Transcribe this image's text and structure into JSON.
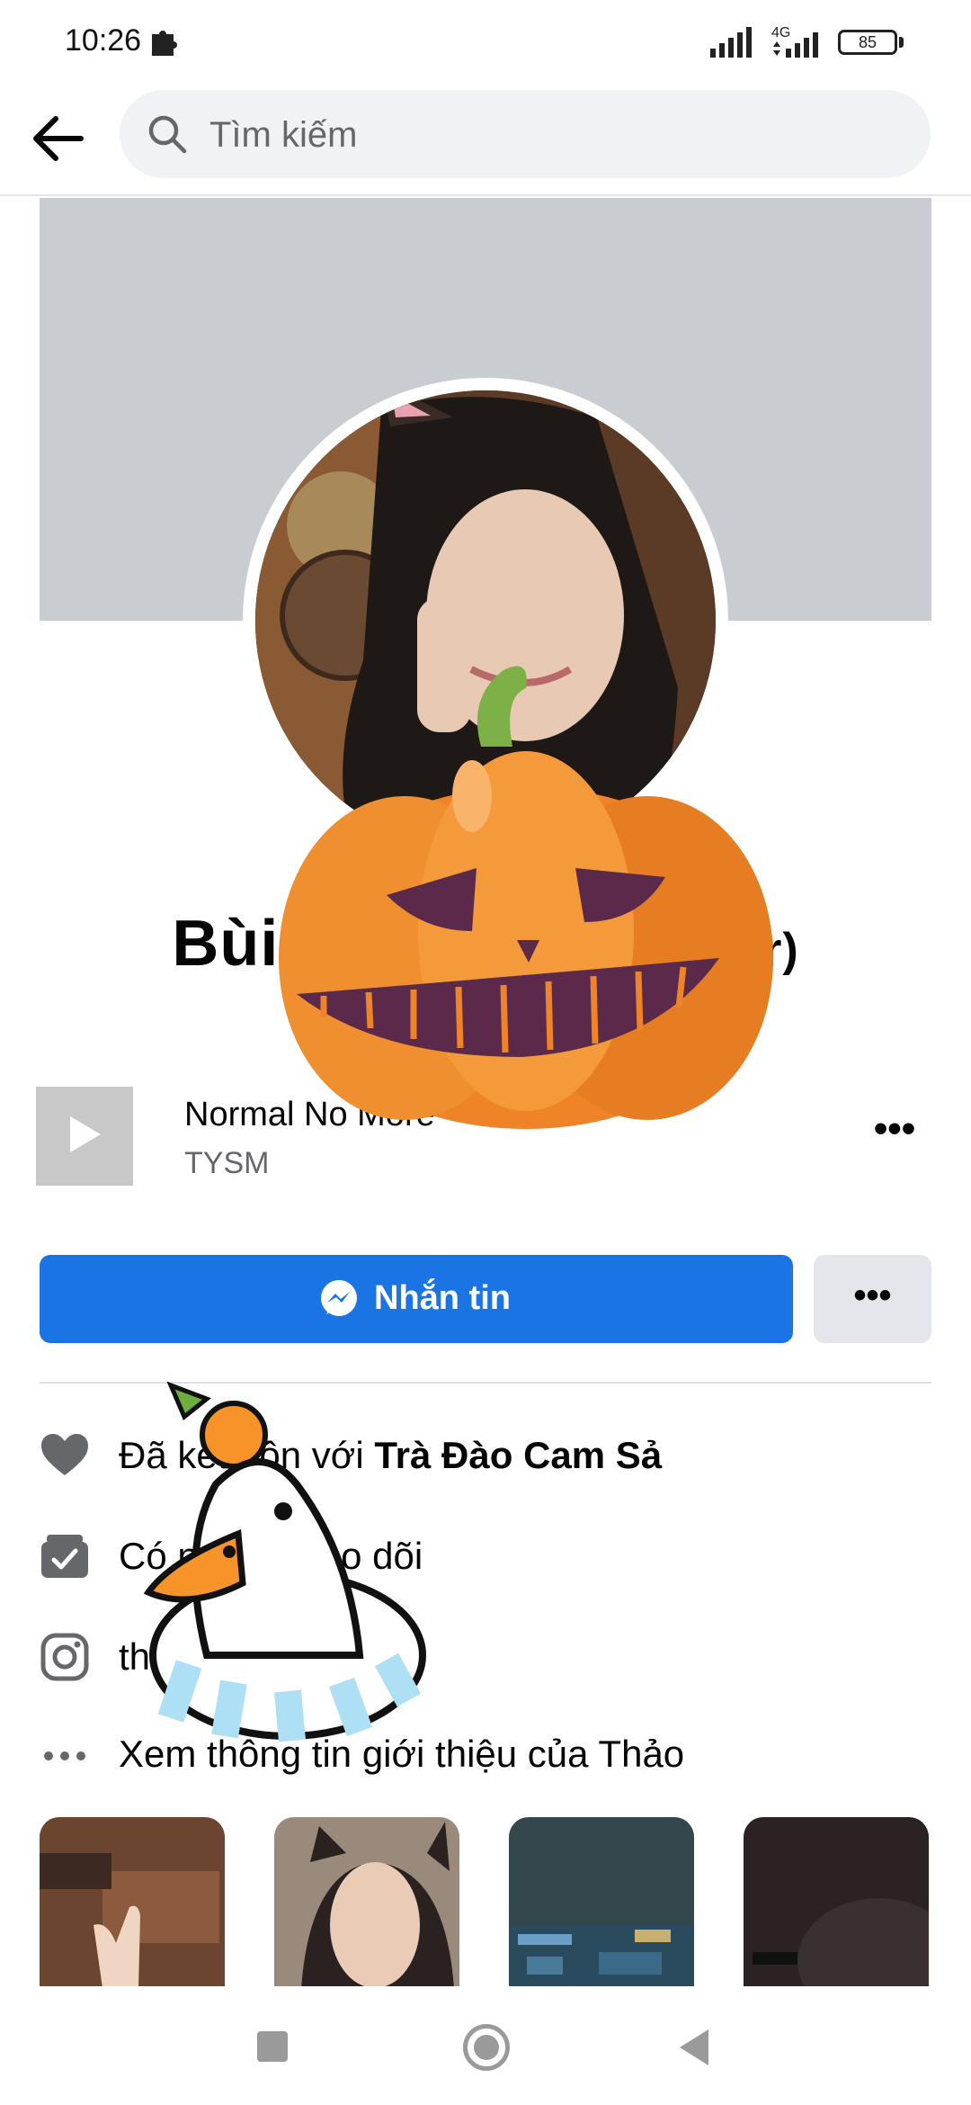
{
  "status_bar": {
    "time": "10:26",
    "network": "4G",
    "battery": "85",
    "battery_level": 0.85
  },
  "header": {
    "search_placeholder": "Tìm kiếm",
    "icons": [
      "back-arrow-icon",
      "search-icon"
    ]
  },
  "profile": {
    "name": "Bùi T",
    "name_suffix": "or)"
  },
  "music": {
    "title": "Normal No More",
    "artist": "TYSM"
  },
  "actions": {
    "message_label": "Nhắn tin",
    "primary_color": "#1b74e4"
  },
  "details": [
    {
      "icon": "heart-icon",
      "prefix": "Đã kết hôn với ",
      "bold": "Trà Đào Cam Sả"
    },
    {
      "icon": "followers-icon",
      "text": "Có người theo dõi"
    },
    {
      "icon": "instagram-icon",
      "text": "thon               la"
    },
    {
      "icon": "more-dots-icon",
      "text": "Xem thông tin giới thiệu của Thảo"
    }
  ],
  "stickers": [
    "pumpkin-sticker",
    "duck-sticker"
  ]
}
